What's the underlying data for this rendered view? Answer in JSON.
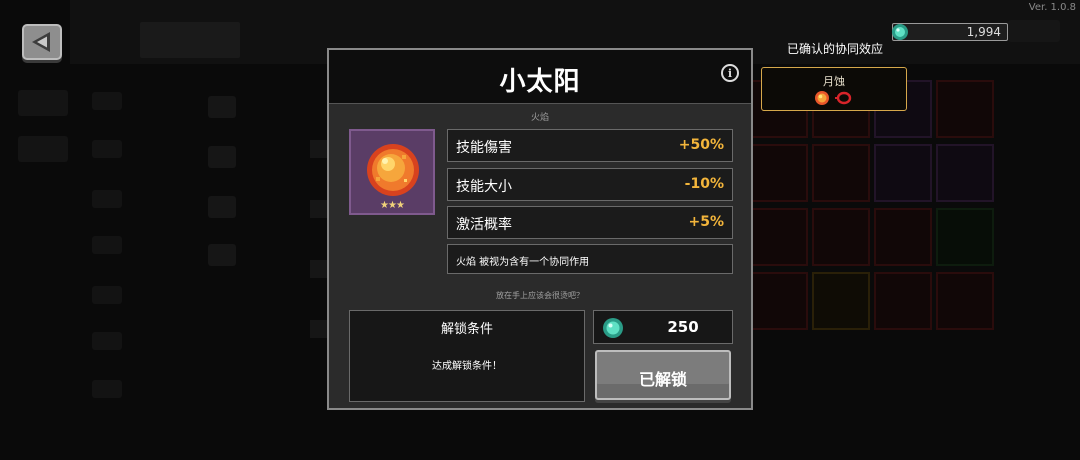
{
  "version": "Ver. 1.0.8",
  "currency": {
    "icon": "gem-icon",
    "amount": "1,994"
  },
  "synergy": {
    "header": "已确认的协同效应",
    "item_name": "月蚀",
    "icons": [
      "sun-orb-icon",
      "red-ring-icon"
    ]
  },
  "item": {
    "title": "小太阳",
    "category": "火焰",
    "icon": "sun-orb-icon",
    "stars": "★★★",
    "stats": [
      {
        "label": "技能傷害",
        "value": "+50%"
      },
      {
        "label": "技能大小",
        "value": "-10%"
      },
      {
        "label": "激活概率",
        "value": "+5%"
      }
    ],
    "note": "火焰 被视为含有一个协同作用",
    "flavor": "放在手上应该会很烫吧？"
  },
  "unlock": {
    "header": "解锁条件",
    "text": "达成解锁条件！",
    "price": "250",
    "button_label": "已解锁"
  },
  "colors": {
    "stat_value": "#f3b53b",
    "item_card_bg": "#5a3d66",
    "synergy_border": "#d6a84b",
    "gem": "#39c9a8"
  }
}
